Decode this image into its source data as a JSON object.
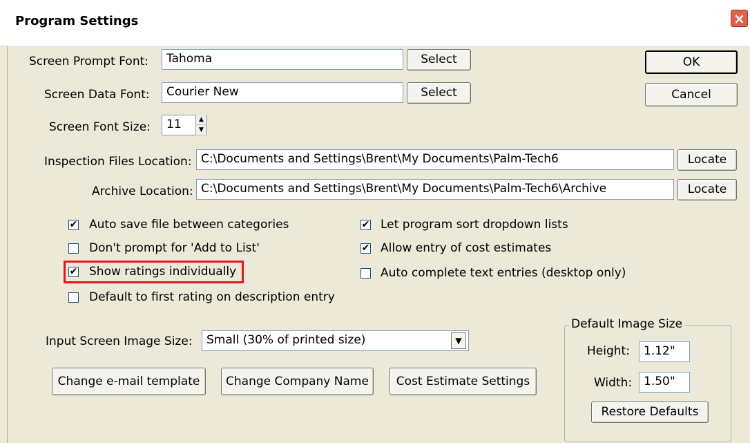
{
  "window": {
    "title": "Program Settings",
    "close_glyph": "×"
  },
  "fonts": {
    "prompt_label": "Screen Prompt Font:",
    "prompt_value": "Tahoma",
    "data_label": "Screen Data Font:",
    "data_value": "Courier New",
    "select_label": "Select",
    "size_label": "Screen Font Size:",
    "size_value": "11"
  },
  "locations": {
    "inspection_label": "Inspection Files Location:",
    "inspection_value": "C:\\Documents and Settings\\Brent\\My Documents\\Palm-Tech6",
    "archive_label": "Archive Location:",
    "archive_value": "C:\\Documents and Settings\\Brent\\My Documents\\Palm-Tech6\\Archive",
    "locate_label": "Locate"
  },
  "checkboxes": {
    "left": [
      {
        "label": "Auto save file between categories",
        "checked": true
      },
      {
        "label": "Don't prompt for 'Add to List'",
        "checked": false
      },
      {
        "label": "Show ratings individually",
        "checked": true
      },
      {
        "label": "Default to first rating on description entry",
        "checked": false
      }
    ],
    "right": [
      {
        "label": "Let program sort dropdown lists",
        "checked": true
      },
      {
        "label": "Allow entry of cost estimates",
        "checked": true
      },
      {
        "label": "Auto complete text entries (desktop only)",
        "checked": false
      }
    ],
    "check_glyph": "✔"
  },
  "image_size": {
    "label": "Input Screen Image Size:",
    "value": "Small (30% of printed size)",
    "dropdown_glyph": "▼"
  },
  "bottom_buttons": {
    "email": "Change e-mail template",
    "company": "Change Company Name",
    "cost": "Cost Estimate Settings"
  },
  "default_image": {
    "legend": "Default Image Size",
    "height_label": "Height:",
    "height_value": "1.12\"",
    "width_label": "Width:",
    "width_value": "1.50\"",
    "restore_label": "Restore Defaults"
  },
  "actions": {
    "ok": "OK",
    "cancel": "Cancel"
  },
  "colors": {
    "highlight": "#E8131D",
    "background": "#ECE9D8"
  }
}
